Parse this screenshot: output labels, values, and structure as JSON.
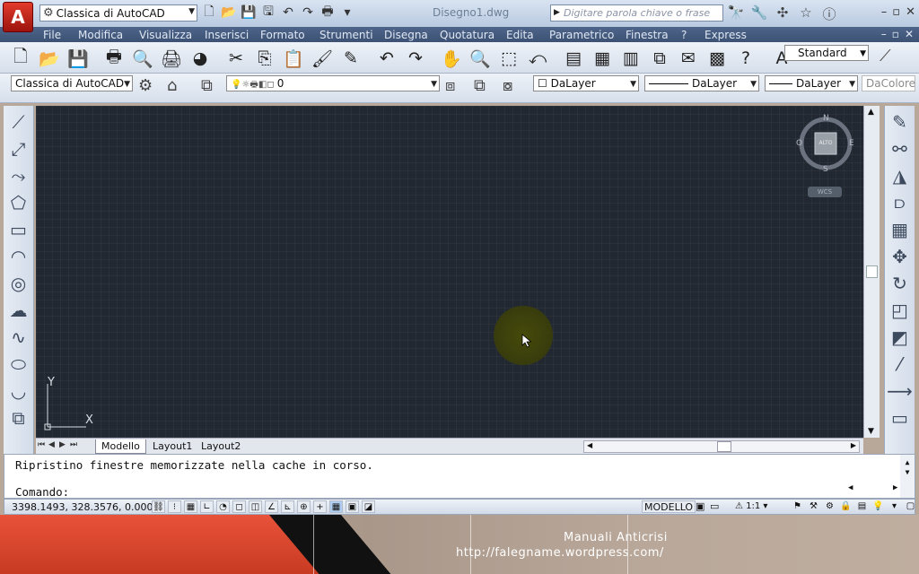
{
  "titlebar": {
    "app_logo": "A",
    "workspace": "Classica di AutoCAD",
    "doc_title": "Disegno1.dwg",
    "search_placeholder": "Digitare parola chiave o frase",
    "window_controls": [
      "–",
      "▫",
      "✕"
    ]
  },
  "menu": {
    "items": [
      "File",
      "Modifica",
      "Visualizza",
      "Inserisci",
      "Formato",
      "Strumenti",
      "Disegna",
      "Quotatura",
      "Edita",
      "Parametrico",
      "Finestra",
      "?",
      "Express"
    ],
    "doc_controls": [
      "–",
      "▫",
      "✕"
    ]
  },
  "toolbar": {
    "text_style": "Standard"
  },
  "layers": {
    "workspace": "Classica di AutoCAD",
    "current_layer": "0",
    "color": "DaLayer",
    "linetype": "DaLayer",
    "lineweight": "DaLayer",
    "plotstyle": "DaColore"
  },
  "viewcube": {
    "north": "N",
    "south": "S",
    "east": "E",
    "west": "O",
    "face": "ALTO",
    "wcs": "WCS"
  },
  "ucs": {
    "x": "X",
    "y": "Y"
  },
  "tabs": {
    "model": "Modello",
    "layout1": "Layout1",
    "layout2": "Layout2"
  },
  "command": {
    "history": "Ripristino finestre memorizzate nella cache in corso.",
    "prompt": "Comando:"
  },
  "status": {
    "coords": "3398.1493, 328.3576, 0.0000",
    "model": "MODELLO",
    "scale": "1:1"
  },
  "footer": {
    "title": "Manuali Anticrisi",
    "url": "http://falegname.wordpress.com/"
  },
  "colors": {
    "canvas": "#222831",
    "menubar": "#4e6489",
    "accent_red": "#e23b2c"
  }
}
